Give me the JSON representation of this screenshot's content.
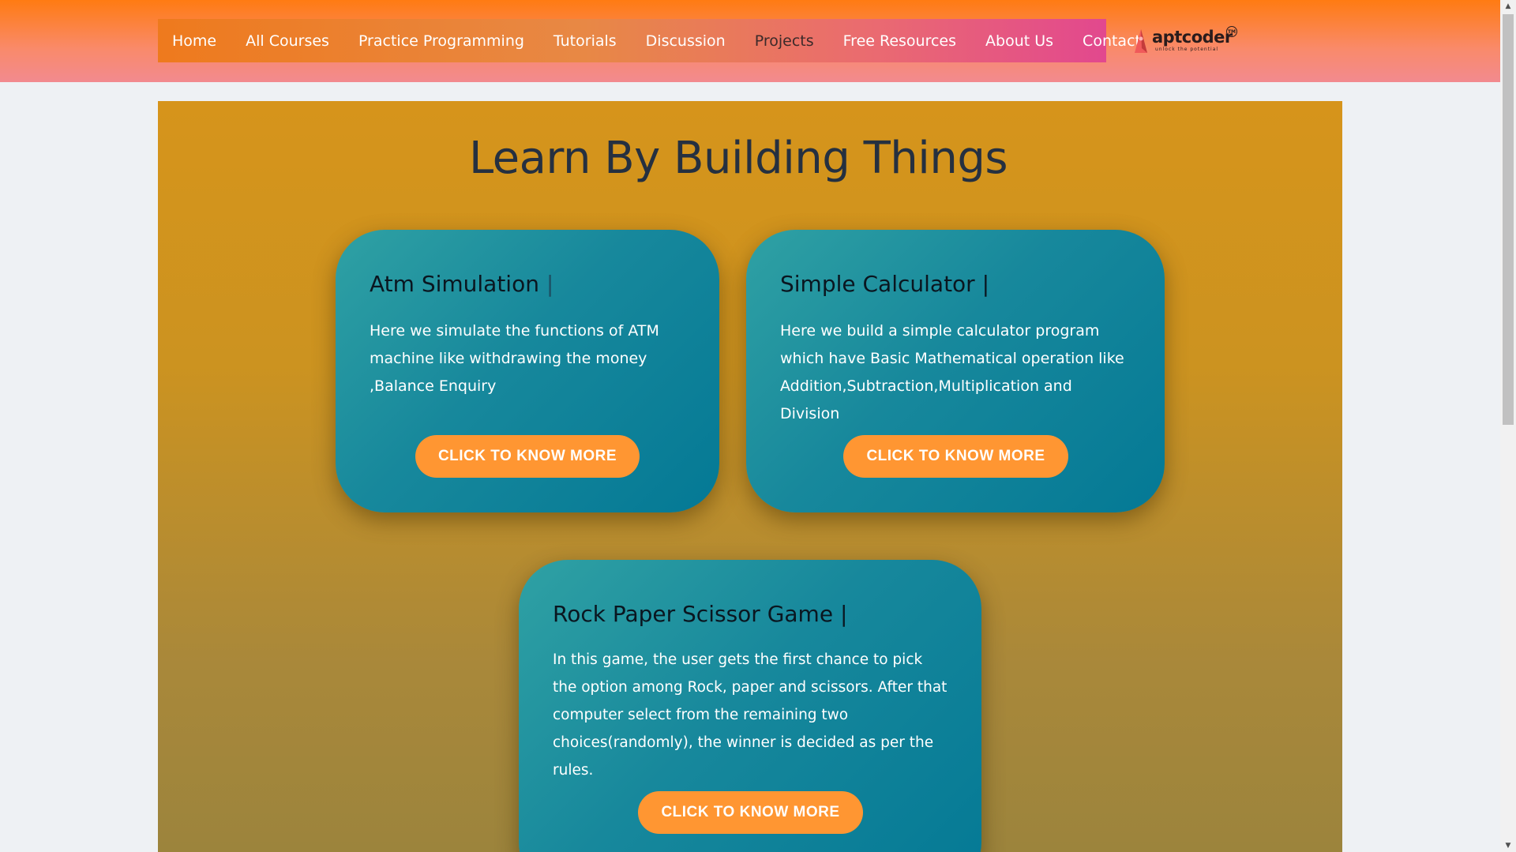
{
  "nav": {
    "items": [
      {
        "label": "Home"
      },
      {
        "label": "All Courses"
      },
      {
        "label": "Practice Programming"
      },
      {
        "label": "Tutorials"
      },
      {
        "label": "Discussion"
      },
      {
        "label": "Projects"
      },
      {
        "label": "Free Resources"
      },
      {
        "label": "About Us"
      },
      {
        "label": "Contact"
      }
    ],
    "active": "Projects"
  },
  "logo": {
    "text": "aptcoder",
    "tagline": "unlock the potential",
    "mark": "TM"
  },
  "section": {
    "title": "Learn By Building Things"
  },
  "cards": [
    {
      "title": "Atm Simulation",
      "cursor": "|",
      "description": "Here we simulate the functions of ATM machine like withdrawing the money ,Balance Enquiry",
      "button": "CLICK TO KNOW MORE"
    },
    {
      "title": "Simple Calculator",
      "cursor": "|",
      "description": "Here we build a simple calculator program which have Basic Mathematical operation like Addition,Subtraction,Multiplication and Division",
      "button": "CLICK TO KNOW MORE"
    },
    {
      "title": "Rock Paper Scissor Game",
      "cursor": "|",
      "description": "In this game, the user gets the first chance to pick the option among Rock, paper and scissors. After that computer select from the remaining two choices(randomly), the winner is decided as per the rules.",
      "button": "CLICK TO KNOW MORE"
    }
  ],
  "colors": {
    "header_top": "#ff7b12",
    "header_bottom": "#f28a8f",
    "section_top": "#d6941b",
    "card_teal": "#17889c",
    "button_orange": "#ff9632"
  }
}
